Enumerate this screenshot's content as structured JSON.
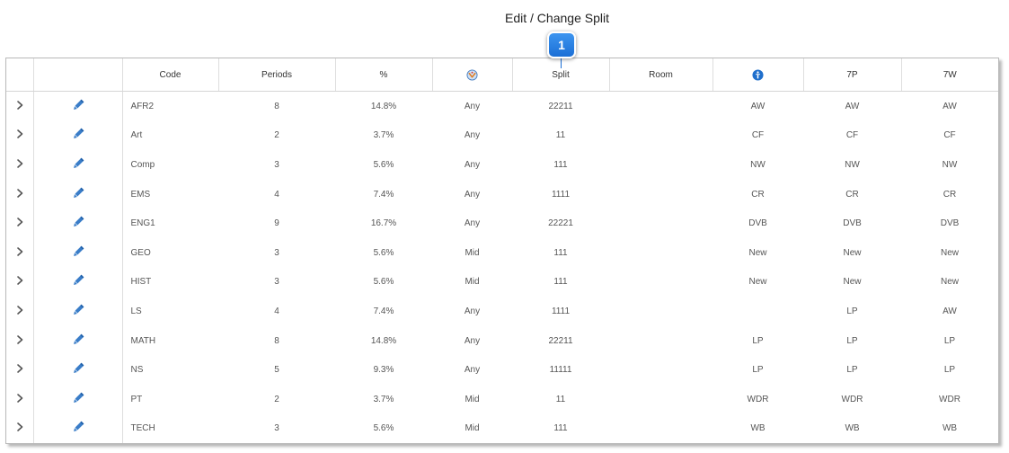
{
  "page_title": "Edit / Change Split",
  "callout_number": "1",
  "colors": {
    "accent": "#1b6fd6",
    "pencil": "#3a7dc8",
    "chevron": "#555555"
  },
  "icons": {
    "expand": "chevron-right-icon",
    "edit": "pencil-icon",
    "period_type": "period-type-icon",
    "teacher": "teacher-info-icon"
  },
  "columns": {
    "code": "Code",
    "periods": "Periods",
    "percent": "%",
    "split": "Split",
    "room": "Room",
    "p7": "7P",
    "w7": "7W"
  },
  "rows": [
    {
      "code": "AFR2",
      "periods": "8",
      "percent": "14.8%",
      "type": "Any",
      "split": "22211",
      "room": "",
      "teacher": "AW",
      "p7": "AW",
      "w7": "AW"
    },
    {
      "code": "Art",
      "periods": "2",
      "percent": "3.7%",
      "type": "Any",
      "split": "11",
      "room": "",
      "teacher": "CF",
      "p7": "CF",
      "w7": "CF"
    },
    {
      "code": "Comp",
      "periods": "3",
      "percent": "5.6%",
      "type": "Any",
      "split": "111",
      "room": "",
      "teacher": "NW",
      "p7": "NW",
      "w7": "NW"
    },
    {
      "code": "EMS",
      "periods": "4",
      "percent": "7.4%",
      "type": "Any",
      "split": "1111",
      "room": "",
      "teacher": "CR",
      "p7": "CR",
      "w7": "CR"
    },
    {
      "code": "ENG1",
      "periods": "9",
      "percent": "16.7%",
      "type": "Any",
      "split": "22221",
      "room": "",
      "teacher": "DVB",
      "p7": "DVB",
      "w7": "DVB"
    },
    {
      "code": "GEO",
      "periods": "3",
      "percent": "5.6%",
      "type": "Mid",
      "split": "111",
      "room": "",
      "teacher": "New",
      "p7": "New",
      "w7": "New"
    },
    {
      "code": "HIST",
      "periods": "3",
      "percent": "5.6%",
      "type": "Mid",
      "split": "111",
      "room": "",
      "teacher": "New",
      "p7": "New",
      "w7": "New"
    },
    {
      "code": "LS",
      "periods": "4",
      "percent": "7.4%",
      "type": "Any",
      "split": "1111",
      "room": "",
      "teacher": "",
      "p7": "LP",
      "w7": "AW"
    },
    {
      "code": "MATH",
      "periods": "8",
      "percent": "14.8%",
      "type": "Any",
      "split": "22211",
      "room": "",
      "teacher": "LP",
      "p7": "LP",
      "w7": "LP"
    },
    {
      "code": "NS",
      "periods": "5",
      "percent": "9.3%",
      "type": "Any",
      "split": "11111",
      "room": "",
      "teacher": "LP",
      "p7": "LP",
      "w7": "LP"
    },
    {
      "code": "PT",
      "periods": "2",
      "percent": "3.7%",
      "type": "Mid",
      "split": "11",
      "room": "",
      "teacher": "WDR",
      "p7": "WDR",
      "w7": "WDR"
    },
    {
      "code": "TECH",
      "periods": "3",
      "percent": "5.6%",
      "type": "Mid",
      "split": "111",
      "room": "",
      "teacher": "WB",
      "p7": "WB",
      "w7": "WB"
    }
  ]
}
